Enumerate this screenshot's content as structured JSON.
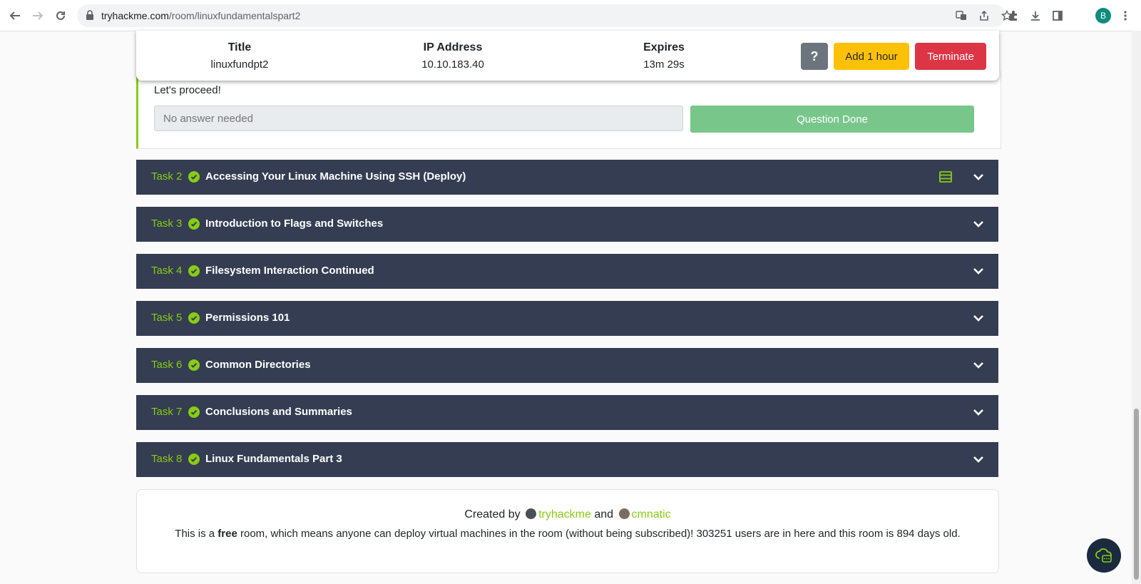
{
  "browser": {
    "url_domain": "tryhackme.com",
    "url_path": "/room/linuxfundamentalspart2",
    "profile_initial": "B"
  },
  "machine": {
    "title_label": "Title",
    "title_value": "linuxfundpt2",
    "ip_label": "IP Address",
    "ip_value": "10.10.183.40",
    "expires_label": "Expires",
    "expires_value": "13m 29s",
    "help_label": "?",
    "add_hour_label": "Add 1 hour",
    "terminate_label": "Terminate"
  },
  "task1": {
    "text": "Let's proceed!",
    "answer_placeholder": "No answer needed",
    "done_label": "Question Done"
  },
  "tasks": [
    {
      "num": "Task 2",
      "title": "Accessing Your Linux Machine Using SSH (Deploy)"
    },
    {
      "num": "Task 3",
      "title": "Introduction to Flags and Switches"
    },
    {
      "num": "Task 4",
      "title": "Filesystem Interaction Continued"
    },
    {
      "num": "Task 5",
      "title": "Permissions 101"
    },
    {
      "num": "Task 6",
      "title": "Common Directories"
    },
    {
      "num": "Task 7",
      "title": "Conclusions and Summaries"
    },
    {
      "num": "Task 8",
      "title": "Linux Fundamentals Part 3"
    }
  ],
  "footer": {
    "created_by": "Created by",
    "author1": "tryhackme",
    "and": "and",
    "author2": "cmnatic",
    "desc_pre": "This is a ",
    "desc_bold": "free",
    "desc_post": " room, which means anyone can deploy virtual machines in the room (without being subscribed)! 303251 users are in here and this room is 894 days old."
  },
  "colors": {
    "accent_green": "#88cc14",
    "task_bg": "#343d52",
    "terminate_red": "#dc3545",
    "add_hour_yellow": "#ffc107"
  }
}
